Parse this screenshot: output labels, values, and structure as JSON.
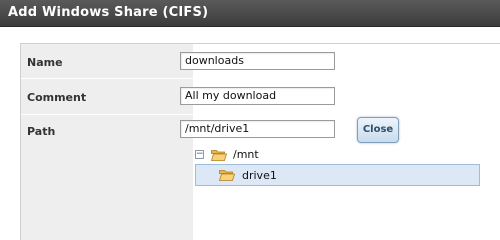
{
  "dialog": {
    "title": "Add Windows Share (CIFS)"
  },
  "form": {
    "name": {
      "label": "Name",
      "value": "downloads"
    },
    "comment": {
      "label": "Comment",
      "value": "All my download"
    },
    "path": {
      "label": "Path",
      "value": "/mnt/drive1"
    },
    "close_label": "Close"
  },
  "tree": {
    "root": {
      "label": "/mnt",
      "icon": "folder-open-icon",
      "expanded": true
    },
    "children": [
      {
        "label": "drive1",
        "icon": "folder-open-icon",
        "selected": true
      }
    ]
  },
  "colors": {
    "titlebar": "#4a4a4a",
    "selection": "#dce8f5",
    "button_text": "#2d4f6e"
  }
}
